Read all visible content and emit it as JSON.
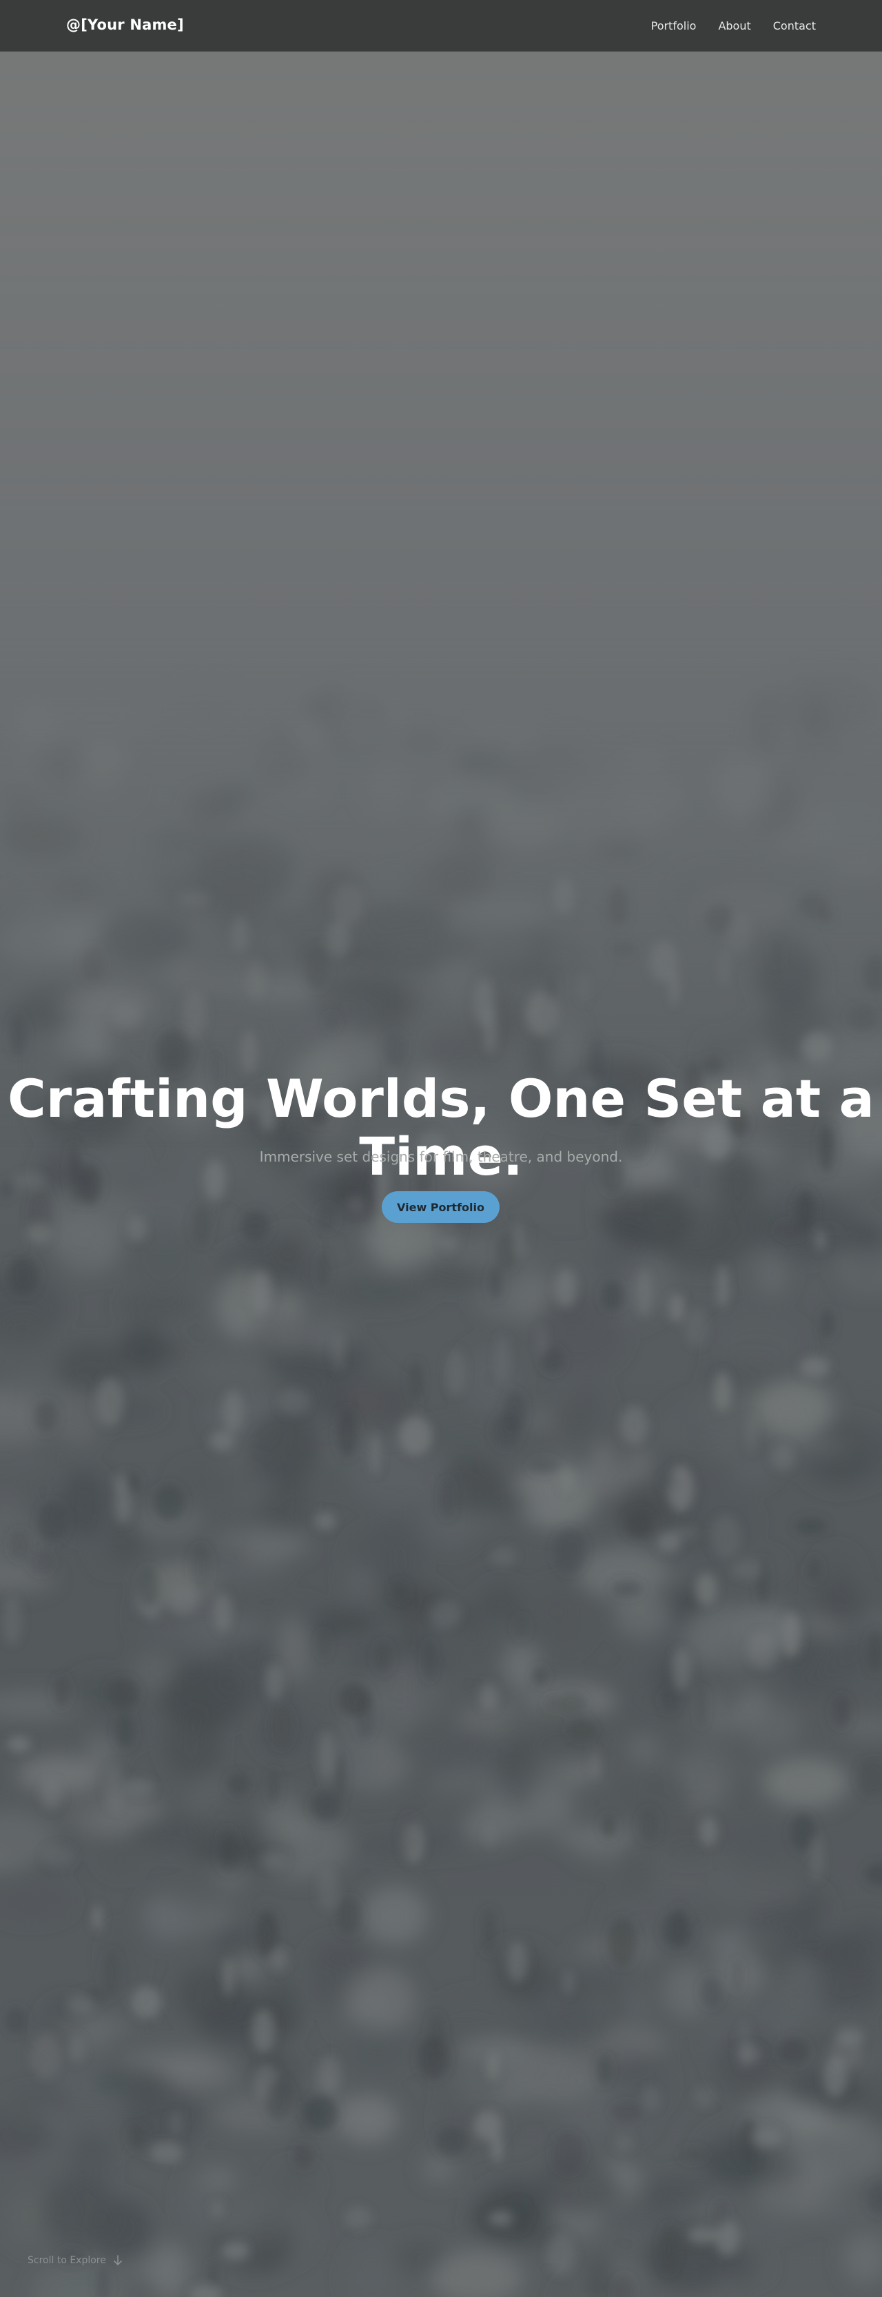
{
  "header": {
    "brand": "@[Your Name]",
    "nav": [
      "Portfolio",
      "About",
      "Contact"
    ]
  },
  "hero": {
    "title": "Crafting Worlds, One Set at a Time.",
    "subtitle": "Immersive set designs for film, theatre, and beyond.",
    "cta_label": "View Portfolio",
    "background": "misty-forest-photo"
  },
  "scroll_hint": {
    "label": "Scroll to Explore",
    "icon": "arrow-down-icon"
  },
  "colors": {
    "nav_bg": "#3a3c3c",
    "accent": "#5aa0d0",
    "text": "#ffffff",
    "muted": "#a9abab"
  }
}
